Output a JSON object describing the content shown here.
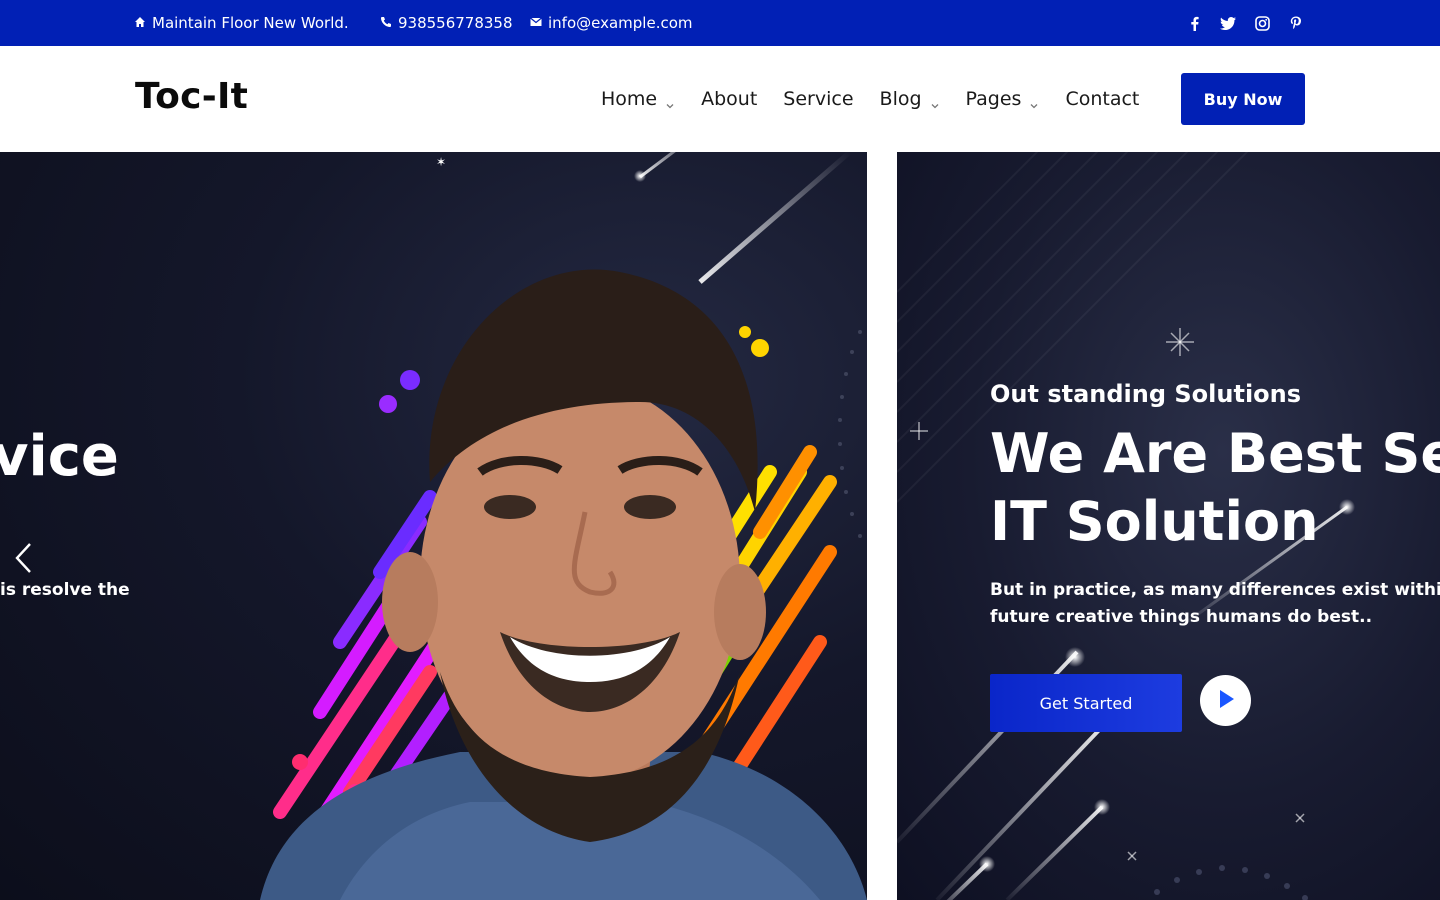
{
  "topbar": {
    "address": "Maintain Floor New World.",
    "phone": "938556778358",
    "email": "info@example.com",
    "address_icon": "home-icon",
    "phone_icon": "phone-icon",
    "email_icon": "envelope-icon",
    "social": [
      "facebook-icon",
      "twitter-icon",
      "instagram-icon",
      "pinterest-icon"
    ],
    "background": "#0120b5"
  },
  "header": {
    "logo": "Toc-It",
    "nav": {
      "home": "Home",
      "about": "About",
      "service": "Service",
      "blog": "Blog",
      "pages": "Pages",
      "contact": "Contact"
    },
    "buy_label": "Buy Now"
  },
  "slider": {
    "prev_slide": {
      "heading_fragment": "vice",
      "text_fragment": "is resolve the"
    },
    "current_slide": {
      "subtitle": "Out standing Solutions",
      "title_line1": "We Are Best Se",
      "title_line2": "IT Solution",
      "desc_line1": "But in practice, as many differences exist within the",
      "desc_line2": "future creative things humans do best..",
      "cta_label": "Get Started"
    }
  },
  "colors": {
    "accent": "#0120b5",
    "slide_background": "#14172a"
  }
}
